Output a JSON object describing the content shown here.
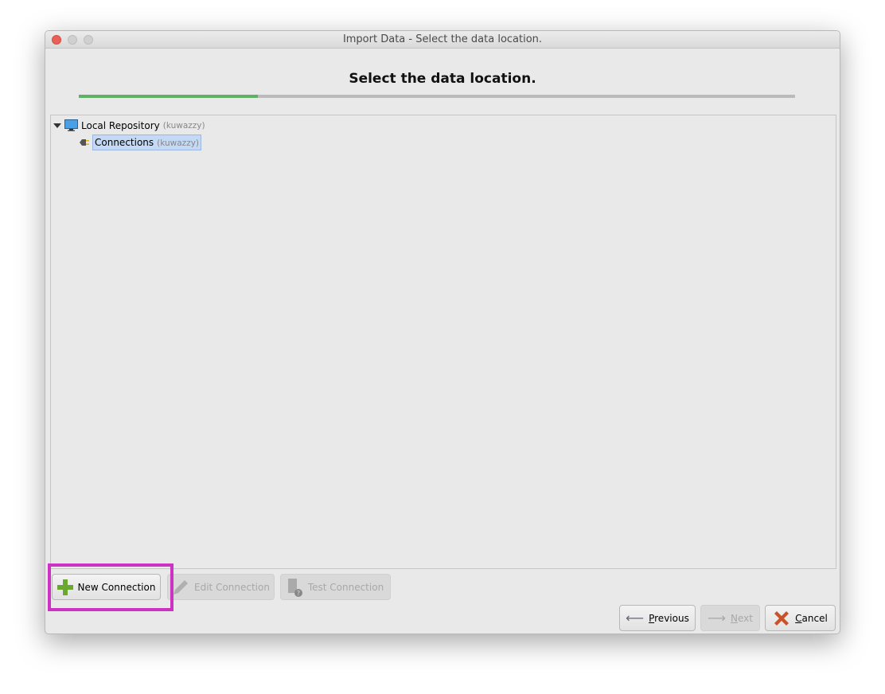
{
  "window": {
    "title": "Import Data - Select the data location."
  },
  "heading": "Select the data location.",
  "progress": {
    "fraction": 0.25,
    "fill_color": "#5db162"
  },
  "tree": {
    "root": {
      "label": "Local Repository",
      "sub": "(kuwazzy)",
      "icon": "monitor-icon",
      "expanded": true
    },
    "child": {
      "label": "Connections",
      "sub": "(kuwazzy)",
      "icon": "plug-icon",
      "selected": true
    }
  },
  "buttons": {
    "new_connection": "New Connection",
    "edit_connection": "Edit Connection",
    "test_connection": "Test Connection",
    "previous_mnemonic": "P",
    "previous_rest": "revious",
    "next_mnemonic": "N",
    "next_rest": "ext",
    "cancel_mnemonic": "C",
    "cancel_rest": "ancel"
  },
  "highlight_color": "#cc33c2"
}
